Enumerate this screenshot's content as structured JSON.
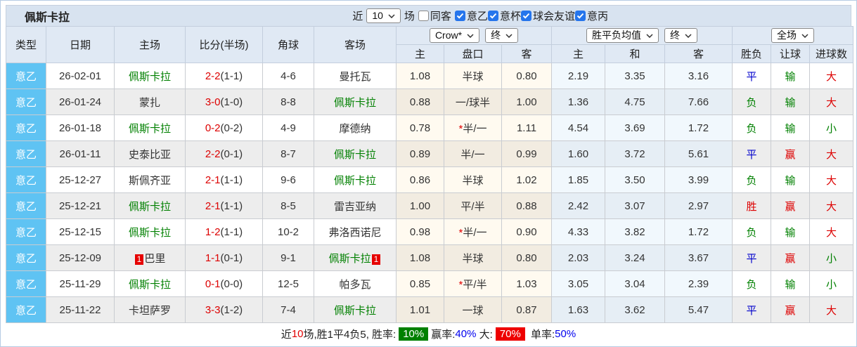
{
  "title": "佩斯卡拉",
  "controls": {
    "recent_label": "近",
    "recent_value": "10",
    "games_label": "场",
    "same_venue_label": "同客",
    "filters": [
      {
        "label": "意乙",
        "checked": true
      },
      {
        "label": "意杯",
        "checked": true
      },
      {
        "label": "球会友谊",
        "checked": true
      },
      {
        "label": "意丙",
        "checked": true
      }
    ]
  },
  "header": {
    "columns": [
      "类型",
      "日期",
      "主场",
      "比分(半场)",
      "角球",
      "客场"
    ],
    "odds_company": "Crow*",
    "odds_state": "终",
    "avg_name": "胜平负均值",
    "avg_state": "终",
    "period": "全场",
    "odds_subcols": [
      "主",
      "盘口",
      "客"
    ],
    "avg_subcols": [
      "主",
      "和",
      "客"
    ],
    "result_subcols": [
      "胜负",
      "让球",
      "进球数"
    ]
  },
  "colors": {
    "team_highlight": "#008000",
    "score": "#dd0000",
    "type_cell": "#5fc3f3",
    "win": "#dd0000",
    "draw": "#0000cc",
    "lose": "#008000"
  },
  "rows": [
    {
      "league": "意乙",
      "date": "26-02-01",
      "home": {
        "name": "佩斯卡拉",
        "green": true,
        "badge_before": "",
        "badge_after": ""
      },
      "score": {
        "ft": "2-2",
        "ht": "(1-1)"
      },
      "corner": "4-6",
      "away": {
        "name": "曼托瓦",
        "green": false,
        "badge_before": "",
        "badge_after": ""
      },
      "odds_home": "1.08",
      "pan": {
        "star": false,
        "text": "半球"
      },
      "odds_away": "0.80",
      "avg": [
        "2.19",
        "3.35",
        "3.16"
      ],
      "result": {
        "text": "平",
        "color": "blue"
      },
      "let": {
        "text": "输",
        "color": "green"
      },
      "goal": {
        "text": "大",
        "color": "red"
      }
    },
    {
      "league": "意乙",
      "date": "26-01-24",
      "home": {
        "name": "蒙扎",
        "green": false,
        "badge_before": "",
        "badge_after": ""
      },
      "score": {
        "ft": "3-0",
        "ht": "(1-0)"
      },
      "corner": "8-8",
      "away": {
        "name": "佩斯卡拉",
        "green": true,
        "badge_before": "",
        "badge_after": ""
      },
      "odds_home": "0.88",
      "pan": {
        "star": false,
        "text": "一/球半"
      },
      "odds_away": "1.00",
      "avg": [
        "1.36",
        "4.75",
        "7.66"
      ],
      "result": {
        "text": "负",
        "color": "green"
      },
      "let": {
        "text": "输",
        "color": "green"
      },
      "goal": {
        "text": "大",
        "color": "red"
      }
    },
    {
      "league": "意乙",
      "date": "26-01-18",
      "home": {
        "name": "佩斯卡拉",
        "green": true,
        "badge_before": "",
        "badge_after": ""
      },
      "score": {
        "ft": "0-2",
        "ht": "(0-2)"
      },
      "corner": "4-9",
      "away": {
        "name": "摩德纳",
        "green": false,
        "badge_before": "",
        "badge_after": ""
      },
      "odds_home": "0.78",
      "pan": {
        "star": true,
        "text": "半/一"
      },
      "odds_away": "1.11",
      "avg": [
        "4.54",
        "3.69",
        "1.72"
      ],
      "result": {
        "text": "负",
        "color": "green"
      },
      "let": {
        "text": "输",
        "color": "green"
      },
      "goal": {
        "text": "小",
        "color": "green"
      }
    },
    {
      "league": "意乙",
      "date": "26-01-11",
      "home": {
        "name": "史泰比亚",
        "green": false,
        "badge_before": "",
        "badge_after": ""
      },
      "score": {
        "ft": "2-2",
        "ht": "(0-1)"
      },
      "corner": "8-7",
      "away": {
        "name": "佩斯卡拉",
        "green": true,
        "badge_before": "",
        "badge_after": ""
      },
      "odds_home": "0.89",
      "pan": {
        "star": false,
        "text": "半/一"
      },
      "odds_away": "0.99",
      "avg": [
        "1.60",
        "3.72",
        "5.61"
      ],
      "result": {
        "text": "平",
        "color": "blue"
      },
      "let": {
        "text": "赢",
        "color": "red"
      },
      "goal": {
        "text": "大",
        "color": "red"
      }
    },
    {
      "league": "意乙",
      "date": "25-12-27",
      "home": {
        "name": "斯佩齐亚",
        "green": false,
        "badge_before": "",
        "badge_after": ""
      },
      "score": {
        "ft": "2-1",
        "ht": "(1-1)"
      },
      "corner": "9-6",
      "away": {
        "name": "佩斯卡拉",
        "green": true,
        "badge_before": "",
        "badge_after": ""
      },
      "odds_home": "0.86",
      "pan": {
        "star": false,
        "text": "半球"
      },
      "odds_away": "1.02",
      "avg": [
        "1.85",
        "3.50",
        "3.99"
      ],
      "result": {
        "text": "负",
        "color": "green"
      },
      "let": {
        "text": "输",
        "color": "green"
      },
      "goal": {
        "text": "大",
        "color": "red"
      }
    },
    {
      "league": "意乙",
      "date": "25-12-21",
      "home": {
        "name": "佩斯卡拉",
        "green": true,
        "badge_before": "",
        "badge_after": ""
      },
      "score": {
        "ft": "2-1",
        "ht": "(1-1)"
      },
      "corner": "8-5",
      "away": {
        "name": "雷吉亚纳",
        "green": false,
        "badge_before": "",
        "badge_after": ""
      },
      "odds_home": "1.00",
      "pan": {
        "star": false,
        "text": "平/半"
      },
      "odds_away": "0.88",
      "avg": [
        "2.42",
        "3.07",
        "2.97"
      ],
      "result": {
        "text": "胜",
        "color": "red"
      },
      "let": {
        "text": "赢",
        "color": "red"
      },
      "goal": {
        "text": "大",
        "color": "red"
      }
    },
    {
      "league": "意乙",
      "date": "25-12-15",
      "home": {
        "name": "佩斯卡拉",
        "green": true,
        "badge_before": "",
        "badge_after": ""
      },
      "score": {
        "ft": "1-2",
        "ht": "(1-1)"
      },
      "corner": "10-2",
      "away": {
        "name": "弗洛西诺尼",
        "green": false,
        "badge_before": "",
        "badge_after": ""
      },
      "odds_home": "0.98",
      "pan": {
        "star": true,
        "text": "半/一"
      },
      "odds_away": "0.90",
      "avg": [
        "4.33",
        "3.82",
        "1.72"
      ],
      "result": {
        "text": "负",
        "color": "green"
      },
      "let": {
        "text": "输",
        "color": "green"
      },
      "goal": {
        "text": "大",
        "color": "red"
      }
    },
    {
      "league": "意乙",
      "date": "25-12-09",
      "home": {
        "name": "巴里",
        "green": false,
        "badge_before": "1",
        "badge_after": ""
      },
      "score": {
        "ft": "1-1",
        "ht": "(0-1)"
      },
      "corner": "9-1",
      "away": {
        "name": "佩斯卡拉",
        "green": true,
        "badge_before": "",
        "badge_after": "1"
      },
      "odds_home": "1.08",
      "pan": {
        "star": false,
        "text": "半球"
      },
      "odds_away": "0.80",
      "avg": [
        "2.03",
        "3.24",
        "3.67"
      ],
      "result": {
        "text": "平",
        "color": "blue"
      },
      "let": {
        "text": "赢",
        "color": "red"
      },
      "goal": {
        "text": "小",
        "color": "green"
      }
    },
    {
      "league": "意乙",
      "date": "25-11-29",
      "home": {
        "name": "佩斯卡拉",
        "green": true,
        "badge_before": "",
        "badge_after": ""
      },
      "score": {
        "ft": "0-1",
        "ht": "(0-0)"
      },
      "corner": "12-5",
      "away": {
        "name": "帕多瓦",
        "green": false,
        "badge_before": "",
        "badge_after": ""
      },
      "odds_home": "0.85",
      "pan": {
        "star": true,
        "text": "平/半"
      },
      "odds_away": "1.03",
      "avg": [
        "3.05",
        "3.04",
        "2.39"
      ],
      "result": {
        "text": "负",
        "color": "green"
      },
      "let": {
        "text": "输",
        "color": "green"
      },
      "goal": {
        "text": "小",
        "color": "green"
      }
    },
    {
      "league": "意乙",
      "date": "25-11-22",
      "home": {
        "name": "卡坦萨罗",
        "green": false,
        "badge_before": "",
        "badge_after": ""
      },
      "score": {
        "ft": "3-3",
        "ht": "(1-2)"
      },
      "corner": "7-4",
      "away": {
        "name": "佩斯卡拉",
        "green": true,
        "badge_before": "",
        "badge_after": ""
      },
      "odds_home": "1.01",
      "pan": {
        "star": false,
        "text": "一球"
      },
      "odds_away": "0.87",
      "avg": [
        "1.63",
        "3.62",
        "5.47"
      ],
      "result": {
        "text": "平",
        "color": "blue"
      },
      "let": {
        "text": "赢",
        "color": "red"
      },
      "goal": {
        "text": "大",
        "color": "red"
      }
    }
  ],
  "footer": {
    "segments": [
      {
        "text": "近"
      },
      {
        "text": "10",
        "color": "red"
      },
      {
        "text": "场,胜1平4负5, 胜率:"
      },
      {
        "text": "10%",
        "box": "green"
      },
      {
        "text": "赢率:"
      },
      {
        "text": "40%",
        "color": "blue"
      },
      {
        "text": " 大:"
      },
      {
        "text": "70%",
        "box": "red"
      },
      {
        "text": " 单率:"
      },
      {
        "text": "50%",
        "color": "blue"
      }
    ]
  }
}
